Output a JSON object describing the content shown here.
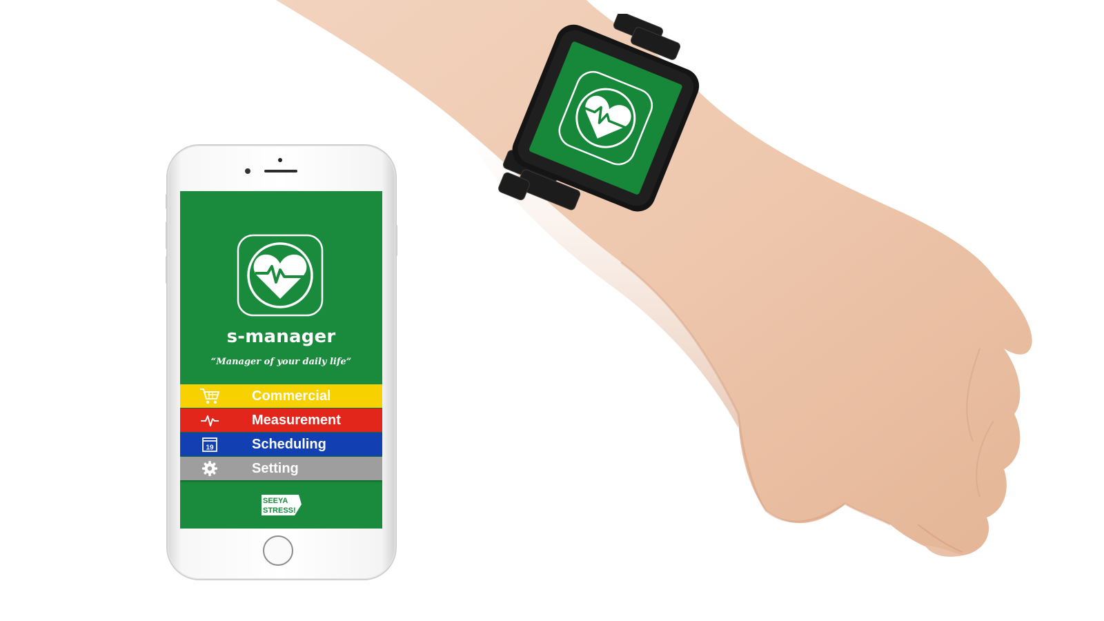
{
  "app": {
    "title": "s-manager",
    "tagline": "“Manager of your daily life”",
    "icon": "heart-pulse-icon"
  },
  "menu": {
    "items": [
      {
        "label": "Commercial",
        "icon": "cart-icon",
        "color": "#f7d200"
      },
      {
        "label": "Measurement",
        "icon": "pulse-icon",
        "color": "#e3261b"
      },
      {
        "label": "Scheduling",
        "icon": "calendar-icon",
        "color": "#1240b3"
      },
      {
        "label": "Setting",
        "icon": "gear-icon",
        "color": "#9e9e9e"
      }
    ],
    "calendar_day": "19"
  },
  "brand": {
    "logo_line1": "SEEYA",
    "logo_line2": "STRESS!"
  },
  "colors": {
    "screen_green": "#1a8a3d",
    "watch_green": "#17873a"
  }
}
